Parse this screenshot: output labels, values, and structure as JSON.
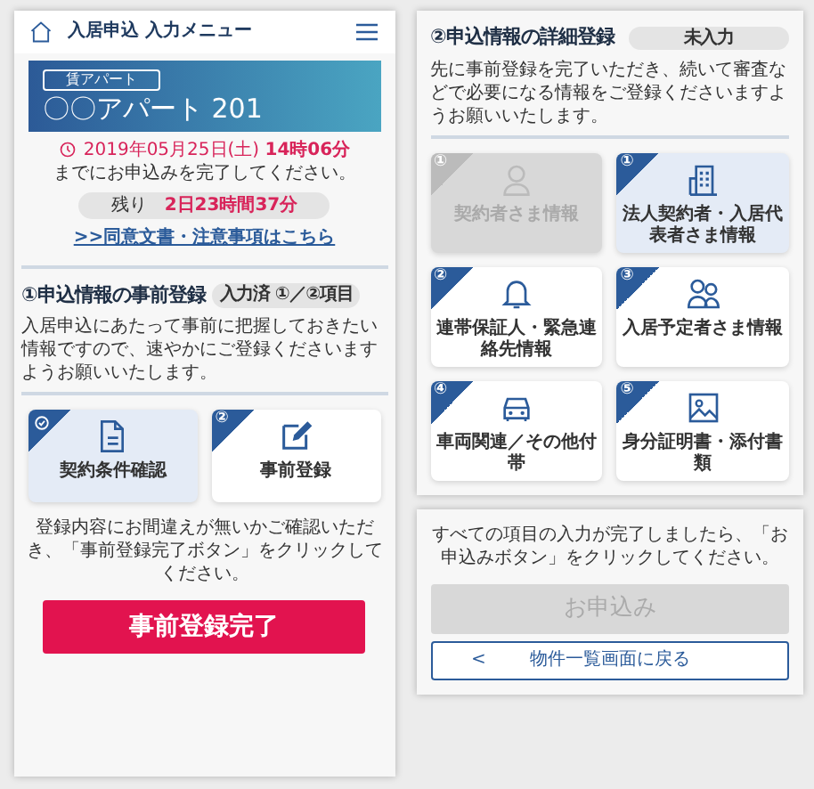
{
  "header": {
    "title": "入居申込 入力メニュー"
  },
  "property": {
    "tag": "賃アパート",
    "name": "〇〇アパート 201"
  },
  "deadline": {
    "date": "2019年05月25日(土) **14時06分**",
    "note": "までにお申込みを完了してください。",
    "remaining_label": "残り",
    "remaining": "2日23時間37分"
  },
  "link": ">>同意文書・注意事項はこちら",
  "step1": {
    "title": "①申込情報の事前登録",
    "badge": "入力済 ①／②項目",
    "description": "入居申込にあたって事前に把握しておきたい情報ですので、速やかにご登録くださいますようお願いいたします。",
    "cards": [
      {
        "label": "契約条件確認",
        "kind": "document",
        "done": true,
        "selected": true,
        "disabled": false
      },
      {
        "number": "②",
        "label": "事前登録",
        "kind": "edit",
        "done": false,
        "selected": false,
        "disabled": false
      }
    ],
    "note": "登録内容にお間違えが無いかご確認いただき、「事前登録完了ボタン」をクリックしてください。",
    "button": {
      "label": "事前登録完了",
      "disabled": false
    }
  },
  "step2": {
    "title": "②申込情報の詳細登録",
    "badge": "未入力",
    "description": "先に事前登録を完了いただき、続いて審査などで必要になる情報をご登録くださいますようお願いいたします。",
    "cards": [
      {
        "number": "①",
        "label": "契約者さま情報",
        "kind": "person",
        "done": false,
        "selected": false,
        "disabled": true
      },
      {
        "number": "①",
        "label": "法人契約者・入居代表者さま情報",
        "kind": "building",
        "done": false,
        "selected": true,
        "disabled": false
      },
      {
        "number": "②",
        "label": "連帯保証人・緊急連絡先情報",
        "kind": "bell",
        "done": false,
        "selected": false,
        "disabled": false
      },
      {
        "number": "③",
        "label": "入居予定者さま情報",
        "kind": "people",
        "done": false,
        "selected": false,
        "disabled": false
      },
      {
        "number": "④",
        "label": "車両関連／その他付帯",
        "kind": "car",
        "done": false,
        "selected": false,
        "disabled": false
      },
      {
        "number": "⑤",
        "label": "身分証明書・添付書類",
        "kind": "image",
        "done": false,
        "selected": false,
        "disabled": false
      }
    ],
    "note": "すべての項目の入力が完了しましたら、「お申込みボタン」をクリックしてください。",
    "button": {
      "label": "お申込み",
      "disabled": true
    },
    "back": {
      "arrow": "<",
      "label": "物件一覧画面に戻る"
    }
  }
}
